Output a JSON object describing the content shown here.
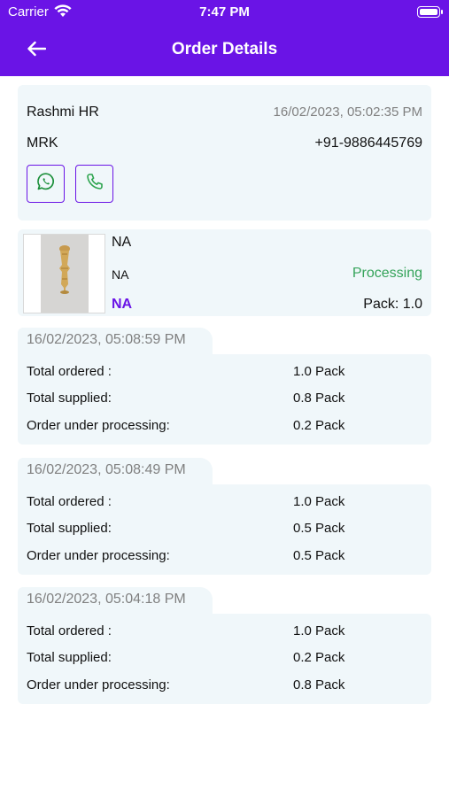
{
  "status_bar": {
    "carrier": "Carrier",
    "time": "7:47 PM"
  },
  "nav": {
    "title": "Order Details",
    "back_icon": "arrow-left-icon"
  },
  "customer": {
    "name": "Rashmi HR",
    "date": "16/02/2023, 05:02:35 PM",
    "shop": "MRK",
    "phone": "+91-9886445769",
    "actions": [
      {
        "icon": "whatsapp-icon",
        "color": "#1b8f3a"
      },
      {
        "icon": "phone-icon",
        "color": "#2da44e"
      }
    ]
  },
  "product": {
    "name": "NA",
    "sub_label": "NA",
    "status": "Processing",
    "code": "NA",
    "pack": "Pack: 1.0"
  },
  "labels": {
    "total_ordered": "Total ordered :",
    "total_supplied": "Total supplied:",
    "under_processing": "Order under processing:"
  },
  "history": [
    {
      "date": "16/02/2023, 05:08:59 PM",
      "ordered": "1.0 Pack",
      "supplied": "0.8 Pack",
      "processing": "0.2 Pack"
    },
    {
      "date": "16/02/2023, 05:08:49 PM",
      "ordered": "1.0 Pack",
      "supplied": "0.5 Pack",
      "processing": "0.5 Pack"
    },
    {
      "date": "16/02/2023, 05:04:18 PM",
      "ordered": "1.0 Pack",
      "supplied": "0.2 Pack",
      "processing": "0.8 Pack"
    }
  ],
  "colors": {
    "primary": "#6a14e6",
    "card_bg": "#f0f7fa",
    "status_green": "#35a35a",
    "muted": "#808080"
  }
}
